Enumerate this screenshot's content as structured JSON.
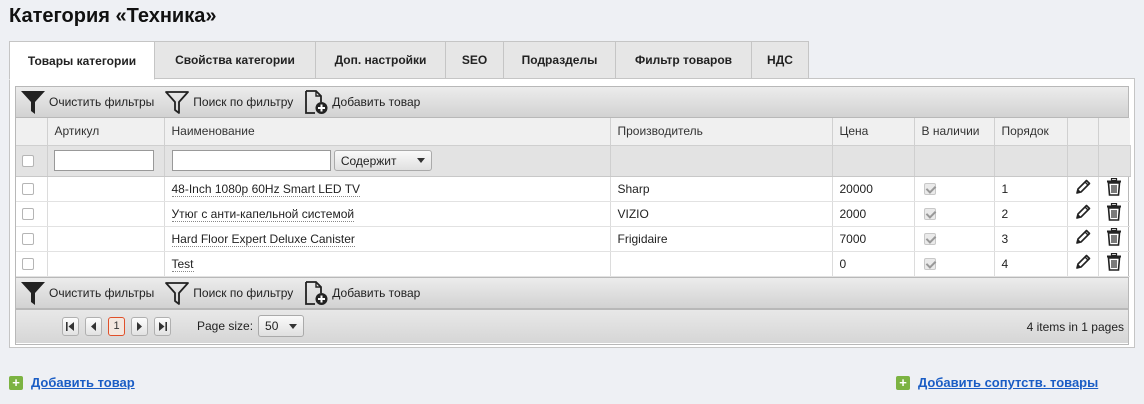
{
  "page": {
    "title": "Категория «Техника»"
  },
  "tabs": [
    {
      "label": "Товары категории",
      "active": true
    },
    {
      "label": "Свойства категории",
      "active": false
    },
    {
      "label": "Доп. настройки",
      "active": false
    },
    {
      "label": "SEO",
      "active": false
    },
    {
      "label": "Подразделы",
      "active": false
    },
    {
      "label": "Фильтр товаров",
      "active": false
    },
    {
      "label": "НДС",
      "active": false
    }
  ],
  "toolbar": {
    "clear_filters": "Очистить фильтры",
    "search_filter": "Поиск по фильтру",
    "add_product": "Добавить товар"
  },
  "columns": {
    "sku": "Артикул",
    "name": "Наименование",
    "manufacturer": "Производитель",
    "price": "Цена",
    "in_stock": "В наличии",
    "order": "Порядок"
  },
  "filters": {
    "sku_value": "",
    "name_value": "",
    "match_mode": "Содержит"
  },
  "rows": [
    {
      "sku": "",
      "name": "48-Inch 1080p 60Hz Smart LED TV",
      "manufacturer": "Sharp",
      "price": "20000",
      "in_stock": true,
      "order": "1"
    },
    {
      "sku": "",
      "name": "Утюг с анти-капельной системой",
      "manufacturer": "VIZIO",
      "price": "2000",
      "in_stock": true,
      "order": "2"
    },
    {
      "sku": "",
      "name": "Hard Floor Expert Deluxe Canister",
      "manufacturer": "Frigidaire",
      "price": "7000",
      "in_stock": true,
      "order": "3"
    },
    {
      "sku": "",
      "name": "Test",
      "manufacturer": "",
      "price": "0",
      "in_stock": true,
      "order": "4"
    }
  ],
  "pager": {
    "current_page": "1",
    "page_size_label": "Page size:",
    "page_size": "50",
    "info": "4 items in 1 pages"
  },
  "footer": {
    "add_product": "Добавить товар",
    "add_related": "Добавить сопутств. товары"
  },
  "colors": {
    "link": "#1a5dc5",
    "plus": "#7cb342",
    "current_page_border": "#e0502a"
  }
}
